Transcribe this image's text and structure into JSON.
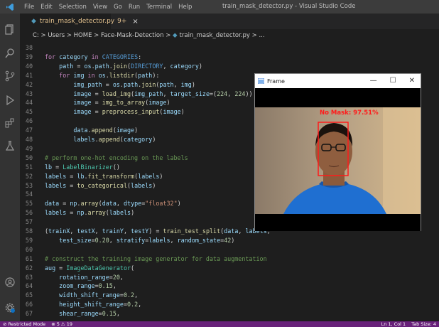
{
  "window": {
    "title": "train_mask_detector.py - Visual Studio Code",
    "menus": [
      "File",
      "Edit",
      "Selection",
      "View",
      "Go",
      "Run",
      "Terminal",
      "Help"
    ]
  },
  "tab": {
    "filename": "train_mask_detector.py",
    "badge": "9+",
    "close": "×"
  },
  "breadcrumb": {
    "text": "C: > Users > HOME > Face-Mask-Detection > ",
    "file": "train_mask_detector.py > ..."
  },
  "status": {
    "mode": "Restricted Mode",
    "problems": "⊗ 5 ⚠ 19",
    "position": "Ln 1, Col 1",
    "tabsize": "Tab Size: 4"
  },
  "frame": {
    "title": "Frame",
    "minimize": "—",
    "maximize": "☐",
    "close": "✕",
    "label": "No Mask: 97.51%"
  },
  "code_lines": [
    {
      "n": "38",
      "t": ""
    },
    {
      "n": "39",
      "t": "for category in CATEGORIES:"
    },
    {
      "n": "40",
      "t": "    path = os.path.join(DIRECTORY, category)"
    },
    {
      "n": "41",
      "t": "    for img in os.listdir(path):"
    },
    {
      "n": "42",
      "t": "        img_path = os.path.join(path, img)"
    },
    {
      "n": "43",
      "t": "        image = load_img(img_path, target_size=(224, 224))"
    },
    {
      "n": "44",
      "t": "        image = img_to_array(image)"
    },
    {
      "n": "45",
      "t": "        image = preprocess_input(image)"
    },
    {
      "n": "46",
      "t": ""
    },
    {
      "n": "47",
      "t": "        data.append(image)"
    },
    {
      "n": "48",
      "t": "        labels.append(category)"
    },
    {
      "n": "49",
      "t": ""
    },
    {
      "n": "50",
      "t": "# perform one-hot encoding on the labels"
    },
    {
      "n": "51",
      "t": "lb = LabelBinarizer()"
    },
    {
      "n": "52",
      "t": "labels = lb.fit_transform(labels)"
    },
    {
      "n": "53",
      "t": "labels = to_categorical(labels)"
    },
    {
      "n": "54",
      "t": ""
    },
    {
      "n": "55",
      "t": "data = np.array(data, dtype=\"float32\")"
    },
    {
      "n": "56",
      "t": "labels = np.array(labels)"
    },
    {
      "n": "57",
      "t": ""
    },
    {
      "n": "58",
      "t": "(trainX, testX, trainY, testY) = train_test_split(data, labels,"
    },
    {
      "n": "59",
      "t": "    test_size=0.20, stratify=labels, random_state=42)"
    },
    {
      "n": "60",
      "t": ""
    },
    {
      "n": "61",
      "t": "# construct the training image generator for data augmentation"
    },
    {
      "n": "62",
      "t": "aug = ImageDataGenerator("
    },
    {
      "n": "63",
      "t": "    rotation_range=20,"
    },
    {
      "n": "64",
      "t": "    zoom_range=0.15,"
    },
    {
      "n": "65",
      "t": "    width_shift_range=0.2,"
    },
    {
      "n": "66",
      "t": "    height_shift_range=0.2,"
    },
    {
      "n": "67",
      "t": "    shear_range=0.15,"
    }
  ],
  "icons": [
    "files-icon",
    "search-icon",
    "source-control-icon",
    "run-debug-icon",
    "extensions-icon",
    "testing-icon",
    "account-icon",
    "settings-gear-icon"
  ]
}
